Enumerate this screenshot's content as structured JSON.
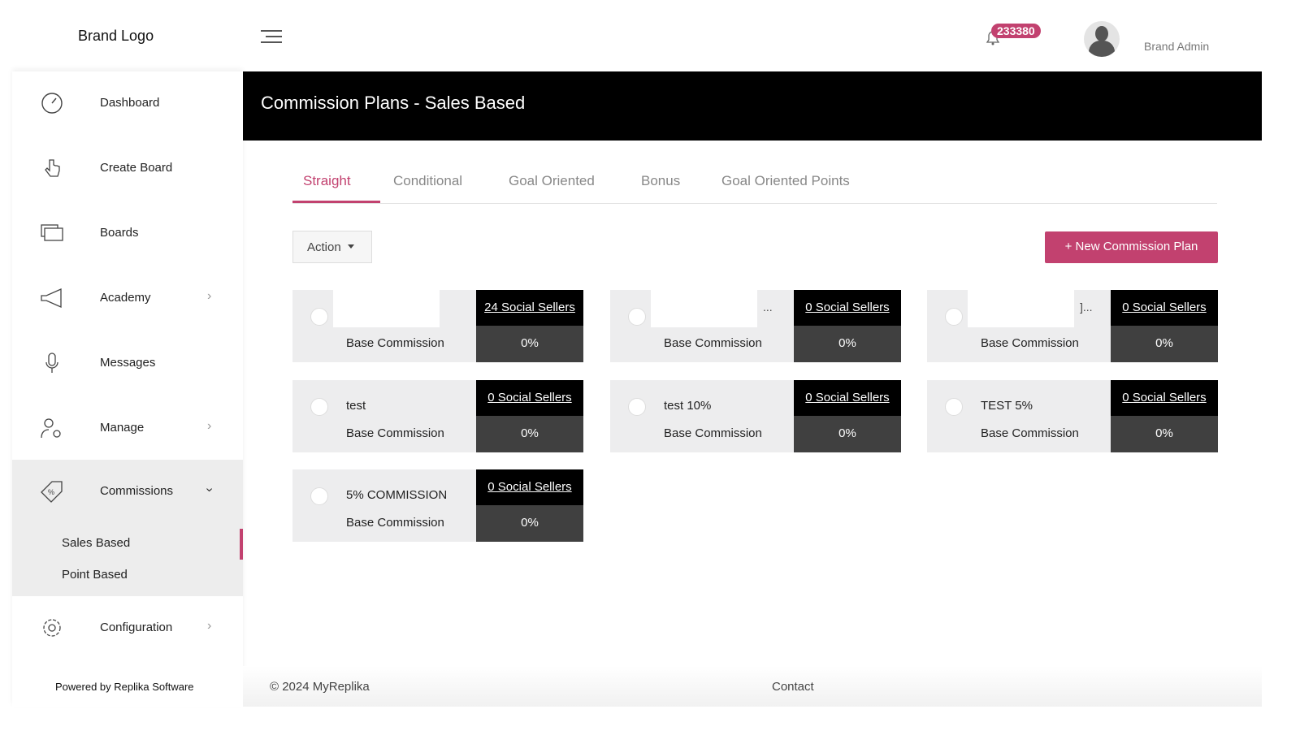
{
  "header": {
    "brand": "Brand Logo",
    "notifications": "233380",
    "user": "Brand Admin"
  },
  "sidebar": {
    "items": [
      {
        "label": "Dashboard",
        "icon": "speedometer-icon"
      },
      {
        "label": "Create Board",
        "icon": "hand-pointer-icon"
      },
      {
        "label": "Boards",
        "icon": "stacked-boards-icon"
      },
      {
        "label": "Academy",
        "icon": "megaphone-icon"
      },
      {
        "label": "Messages",
        "icon": "microphone-icon"
      },
      {
        "label": "Manage",
        "icon": "user-gear-icon"
      },
      {
        "label": "Commissions",
        "icon": "tag-percent-icon"
      },
      {
        "label": "Configuration",
        "icon": "gear-icon"
      }
    ],
    "sub": [
      "Sales Based",
      "Point Based"
    ],
    "powered": "Powered by Replika Software"
  },
  "page": {
    "title": "Commission Plans - Sales Based",
    "tabs": [
      "Straight",
      "Conditional",
      "Goal Oriented",
      "Bonus",
      "Goal Oriented Points"
    ],
    "action": "Action",
    "new_button": "+ New Commission Plan"
  },
  "cards": [
    {
      "title": "",
      "ellipsis": "",
      "sellers": "24 Social Sellers",
      "label": "Base Commission",
      "value": "0%"
    },
    {
      "title": "",
      "ellipsis": "...",
      "sellers": "0 Social Sellers",
      "label": "Base Commission",
      "value": "0%"
    },
    {
      "title": "",
      "ellipsis": "]...",
      "sellers": "0 Social Sellers",
      "label": "Base Commission",
      "value": "0%"
    },
    {
      "title": "test",
      "sellers": "0 Social Sellers",
      "label": "Base Commission",
      "value": "0%"
    },
    {
      "title": "test 10%",
      "sellers": "0 Social Sellers",
      "label": "Base Commission",
      "value": "0%"
    },
    {
      "title": "TEST 5%",
      "sellers": "0 Social Sellers",
      "label": "Base Commission",
      "value": "0%"
    },
    {
      "title": "5% COMMISSION",
      "sellers": "0 Social Sellers",
      "label": "Base Commission",
      "value": "0%"
    }
  ],
  "footer": {
    "copyright": "© 2024 MyReplika",
    "contact": "Contact"
  },
  "colors": {
    "accent": "#c2416f",
    "header": "#000000"
  }
}
